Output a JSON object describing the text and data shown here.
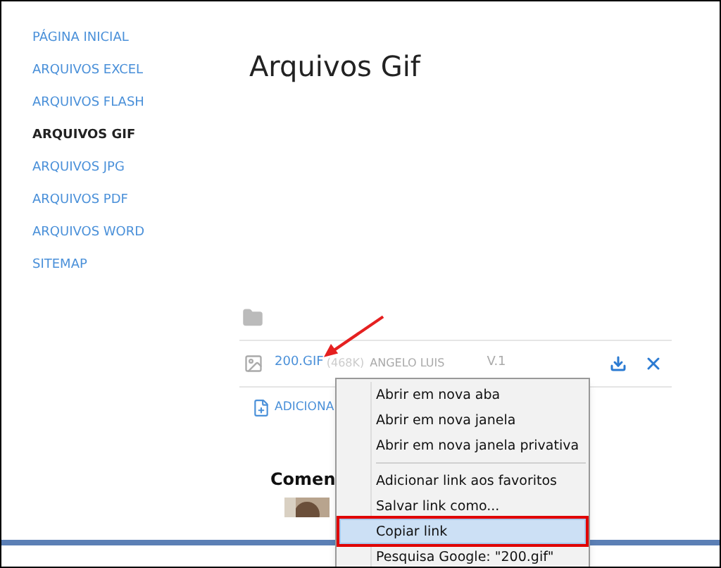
{
  "sidebar": {
    "items": [
      {
        "label": "PÁGINA INICIAL",
        "selected": false
      },
      {
        "label": "ARQUIVOS EXCEL",
        "selected": false
      },
      {
        "label": "ARQUIVOS FLASH",
        "selected": false
      },
      {
        "label": "ARQUIVOS GIF",
        "selected": true
      },
      {
        "label": "ARQUIVOS JPG",
        "selected": false
      },
      {
        "label": "ARQUIVOS PDF",
        "selected": false
      },
      {
        "label": "ARQUIVOS WORD",
        "selected": false
      },
      {
        "label": "SITEMAP",
        "selected": false
      }
    ]
  },
  "page_title": "Arquivos Gif",
  "file_row": {
    "name": "200.GIF",
    "size": "(468K)",
    "author": "ANGELO LUIS",
    "version": "V.1"
  },
  "add_link": "ADICIONA",
  "comments_heading": "Comen",
  "context_menu": {
    "items": [
      {
        "kind": "item",
        "label": "Abrir em nova aba",
        "selected": false
      },
      {
        "kind": "item",
        "label": "Abrir em nova janela",
        "selected": false
      },
      {
        "kind": "item",
        "label": "Abrir em nova janela privativa",
        "selected": false
      },
      {
        "kind": "separator"
      },
      {
        "kind": "item",
        "label": "Adicionar link aos favoritos",
        "selected": false
      },
      {
        "kind": "item",
        "label": "Salvar link como...",
        "selected": false
      },
      {
        "kind": "item",
        "label": "Copiar link",
        "selected": true
      },
      {
        "kind": "item",
        "label": "Pesquisa Google: \"200.gif\"",
        "selected": false
      }
    ]
  }
}
